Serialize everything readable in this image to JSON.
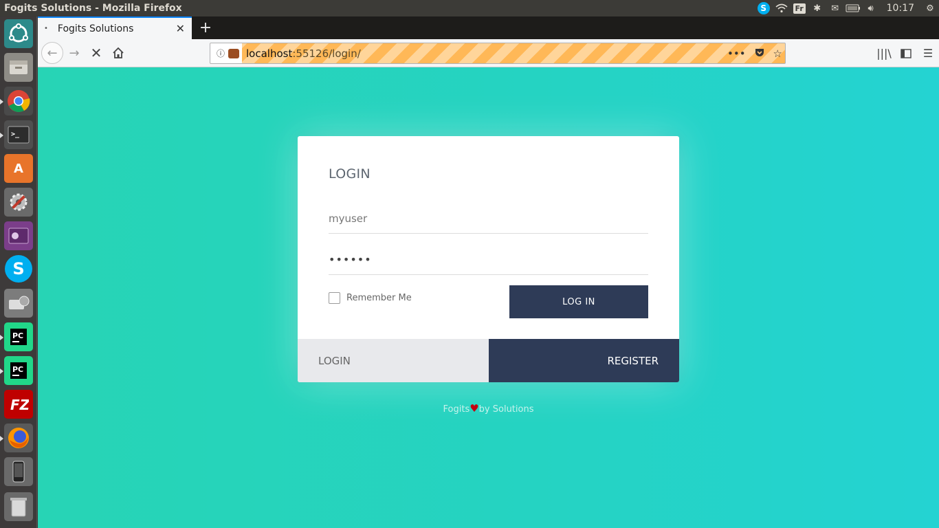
{
  "topbar": {
    "window_title": "Fogits Solutions - Mozilla Firefox",
    "keyboard_layout": "Fr",
    "clock": "10:17"
  },
  "launcher": {
    "apps": [
      "ubuntu-dash",
      "files",
      "chrome",
      "terminal",
      "software-center",
      "system-settings",
      "video-player",
      "skype",
      "disk-tool",
      "pycharm",
      "pycharm",
      "filezilla",
      "firefox",
      "phone",
      "trash"
    ]
  },
  "browser": {
    "tab_label": "Fogits Solutions",
    "url_host": "localhost",
    "url_rest": ":55126/login/"
  },
  "login": {
    "heading": "LOGIN",
    "username_value": "myuser",
    "password_value": "••••••",
    "remember_label": "Remember Me",
    "submit_label": "LOG IN",
    "tab_login": "LOGIN",
    "tab_register": "REGISTER"
  },
  "footer": {
    "left": "Fogits",
    "right": "by Solutions"
  },
  "colors": {
    "accent_dark": "#2e3b57",
    "background": "#25d3c2",
    "heart": "#c40010"
  }
}
